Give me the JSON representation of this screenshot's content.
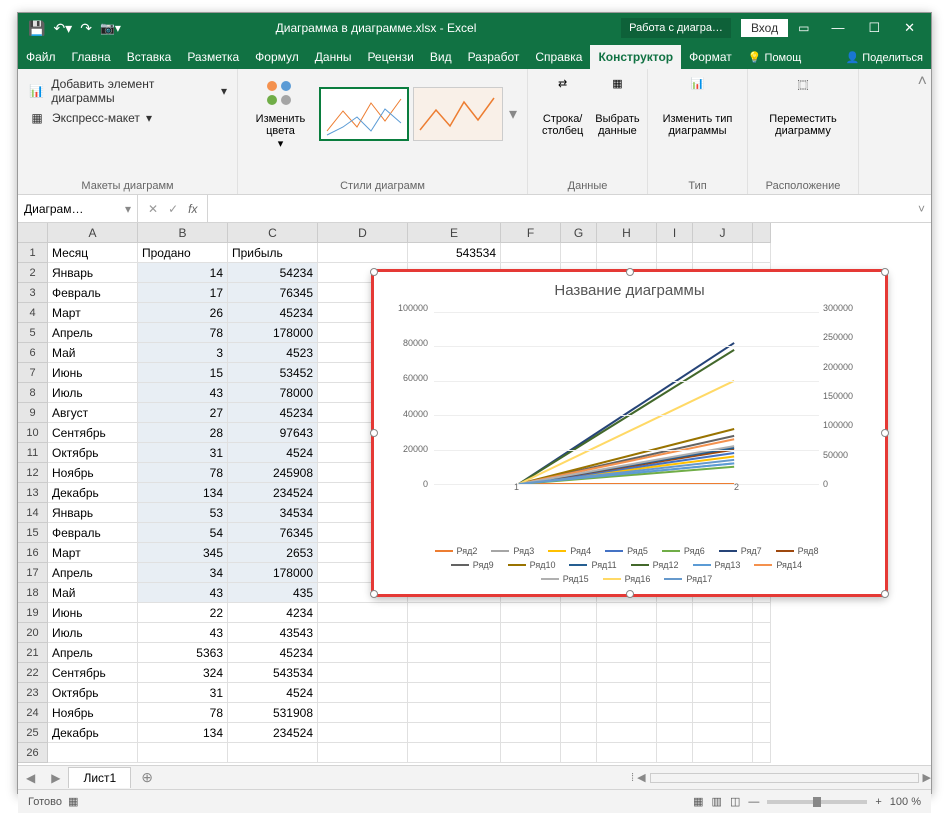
{
  "title": "Диаграмма в диаграмме.xlsx - Excel",
  "context_tab": "Работа с диагра…",
  "login": "Вход",
  "tabs": [
    "Файл",
    "Главна",
    "Вставка",
    "Разметка",
    "Формул",
    "Данны",
    "Рецензи",
    "Вид",
    "Разработ",
    "Справка",
    "Конструктор",
    "Формат"
  ],
  "help_label": "Помощ",
  "share_label": "Поделиться",
  "ribbon": {
    "add_element": "Добавить элемент диаграммы",
    "quick_layout": "Экспресс-макет",
    "layouts_label": "Макеты диаграмм",
    "change_colors": "Изменить цвета",
    "styles_label": "Стили диаграмм",
    "row_col": "Строка/ столбец",
    "select_data": "Выбрать данные",
    "data_label": "Данные",
    "change_type": "Изменить тип диаграммы",
    "type_label": "Тип",
    "move_chart": "Переместить диаграмму",
    "location_label": "Расположение"
  },
  "namebox": "Диаграм…",
  "fx": "fx",
  "columns": [
    "A",
    "B",
    "C",
    "D",
    "E",
    "F",
    "G",
    "H",
    "I",
    "J"
  ],
  "headers": {
    "a": "Месяц",
    "b": "Продано",
    "c": "Прибыль"
  },
  "e1": "543534",
  "rows": [
    {
      "n": "2",
      "a": "Январь",
      "b": "14",
      "c": "54234"
    },
    {
      "n": "3",
      "a": "Февраль",
      "b": "17",
      "c": "76345"
    },
    {
      "n": "4",
      "a": "Март",
      "b": "26",
      "c": "45234"
    },
    {
      "n": "5",
      "a": "Апрель",
      "b": "78",
      "c": "178000"
    },
    {
      "n": "6",
      "a": "Май",
      "b": "3",
      "c": "4523"
    },
    {
      "n": "7",
      "a": "Июнь",
      "b": "15",
      "c": "53452"
    },
    {
      "n": "8",
      "a": "Июль",
      "b": "43",
      "c": "78000"
    },
    {
      "n": "9",
      "a": "Август",
      "b": "27",
      "c": "45234"
    },
    {
      "n": "10",
      "a": "Сентябрь",
      "b": "28",
      "c": "97643"
    },
    {
      "n": "11",
      "a": "Октябрь",
      "b": "31",
      "c": "4524"
    },
    {
      "n": "12",
      "a": "Ноябрь",
      "b": "78",
      "c": "245908"
    },
    {
      "n": "13",
      "a": "Декабрь",
      "b": "134",
      "c": "234524"
    },
    {
      "n": "14",
      "a": "Январь",
      "b": "53",
      "c": "34534"
    },
    {
      "n": "15",
      "a": "Февраль",
      "b": "54",
      "c": "76345"
    },
    {
      "n": "16",
      "a": "Март",
      "b": "345",
      "c": "2653"
    },
    {
      "n": "17",
      "a": "Апрель",
      "b": "34",
      "c": "178000"
    },
    {
      "n": "18",
      "a": "Май",
      "b": "43",
      "c": "435"
    },
    {
      "n": "19",
      "a": "Июнь",
      "b": "22",
      "c": "4234"
    },
    {
      "n": "20",
      "a": "Июль",
      "b": "43",
      "c": "43543"
    },
    {
      "n": "21",
      "a": "Апрель",
      "b": "5363",
      "c": "45234"
    },
    {
      "n": "22",
      "a": "Сентябрь",
      "b": "324",
      "c": "543534"
    },
    {
      "n": "23",
      "a": "Октябрь",
      "b": "31",
      "c": "4524"
    },
    {
      "n": "24",
      "a": "Ноябрь",
      "b": "78",
      "c": "531908"
    },
    {
      "n": "25",
      "a": "Декабрь",
      "b": "134",
      "c": "234524"
    }
  ],
  "sheet_tab": "Лист1",
  "status": "Готово",
  "zoom": "100 %",
  "chart_data": {
    "type": "line",
    "title": "Название диаграммы",
    "x": [
      1,
      2
    ],
    "left_axis": {
      "ticks": [
        0,
        20000,
        40000,
        60000,
        80000,
        100000
      ],
      "ylim": [
        0,
        100000
      ]
    },
    "right_axis": {
      "ticks": [
        0,
        50000,
        100000,
        150000,
        200000,
        250000,
        300000
      ],
      "ylim": [
        0,
        300000
      ]
    },
    "series": [
      {
        "name": "Ряд2",
        "color": "#ed7d31",
        "values": [
          0,
          0
        ]
      },
      {
        "name": "Ряд3",
        "color": "#a5a5a5",
        "values": [
          0,
          12000
        ]
      },
      {
        "name": "Ряд4",
        "color": "#ffc000",
        "values": [
          0,
          16000
        ]
      },
      {
        "name": "Ряд5",
        "color": "#4472c4",
        "values": [
          0,
          18000
        ]
      },
      {
        "name": "Ряд6",
        "color": "#70ad47",
        "values": [
          0,
          10000
        ]
      },
      {
        "name": "Ряд7",
        "color": "#264478",
        "values": [
          0,
          82000
        ]
      },
      {
        "name": "Ряд8",
        "color": "#9e480e",
        "values": [
          0,
          20000
        ]
      },
      {
        "name": "Ряд9",
        "color": "#636363",
        "values": [
          0,
          28000
        ]
      },
      {
        "name": "Ряд10",
        "color": "#997300",
        "values": [
          0,
          32000
        ]
      },
      {
        "name": "Ряд11",
        "color": "#255e91",
        "values": [
          0,
          21000
        ]
      },
      {
        "name": "Ряд12",
        "color": "#43682b",
        "values": [
          0,
          78000
        ]
      },
      {
        "name": "Ряд13",
        "color": "#5b9bd5",
        "values": [
          0,
          12000
        ]
      },
      {
        "name": "Ряд14",
        "color": "#f4914e",
        "values": [
          0,
          26000
        ]
      },
      {
        "name": "Ряд15",
        "color": "#b0b0b0",
        "values": [
          0,
          22000
        ]
      },
      {
        "name": "Ряд16",
        "color": "#ffd966",
        "values": [
          0,
          60000
        ]
      },
      {
        "name": "Ряд17",
        "color": "#6699cc",
        "values": [
          0,
          14000
        ]
      }
    ]
  }
}
